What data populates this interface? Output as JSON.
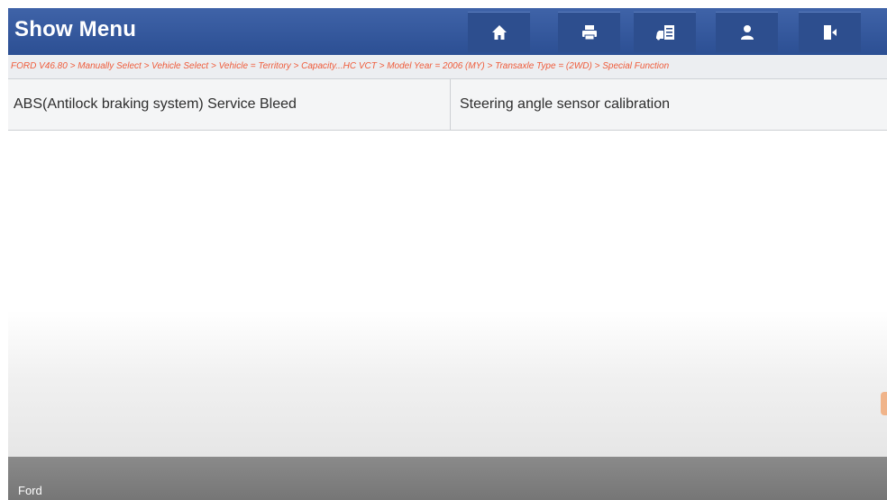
{
  "header": {
    "title": "Show Menu",
    "toolbar": [
      {
        "name": "home-button",
        "icon": "home-icon"
      },
      {
        "name": "print-button",
        "icon": "print-icon"
      },
      {
        "name": "vehicle-info-button",
        "icon": "vehicle-info-icon"
      },
      {
        "name": "user-button",
        "icon": "user-icon"
      },
      {
        "name": "exit-button",
        "icon": "exit-icon"
      }
    ]
  },
  "breadcrumb": {
    "text": "FORD V46.80 > Manually Select > Vehicle Select > Vehicle = Territory > Capacity...HC VCT > Model Year = 2006 (MY) > Transaxle Type = (2WD) > Special Function"
  },
  "menu": {
    "items": [
      {
        "label": "ABS(Antilock braking system)  Service Bleed"
      },
      {
        "label": "Steering angle sensor calibration"
      }
    ]
  },
  "footer": {
    "text": "Ford"
  },
  "colors": {
    "header": "#2c4f93",
    "breadcrumb_text": "#ef5b3a",
    "footer": "#7d7d7d"
  }
}
